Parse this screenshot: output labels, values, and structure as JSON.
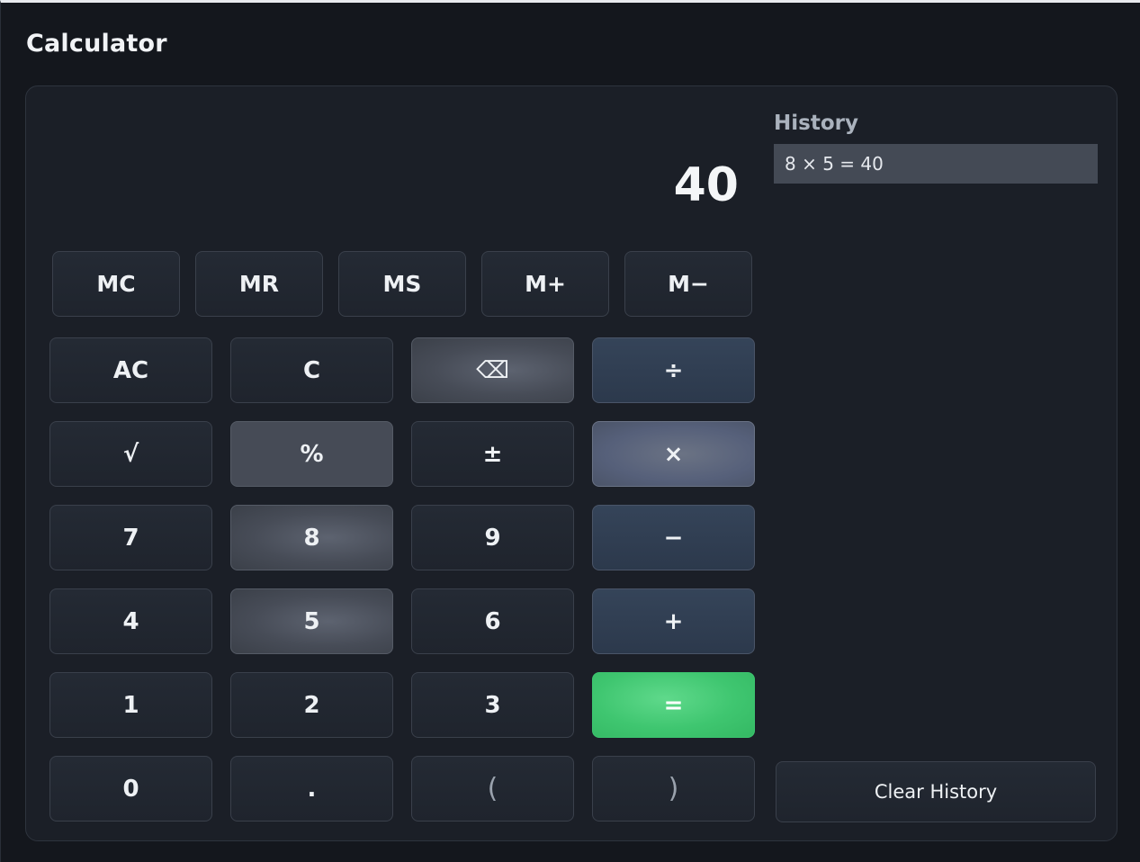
{
  "app": {
    "title": "Calculator"
  },
  "display": {
    "value": "40"
  },
  "memory_buttons": [
    "MC",
    "MR",
    "MS",
    "M+",
    "M−"
  ],
  "keys": {
    "ac": "AC",
    "c": "C",
    "backspace": "⌫",
    "divide": "÷",
    "sqrt": "√",
    "percent": "%",
    "plusminus": "±",
    "multiply": "×",
    "seven": "7",
    "eight": "8",
    "nine": "9",
    "minus": "−",
    "four": "4",
    "five": "5",
    "six": "6",
    "plus": "+",
    "one": "1",
    "two": "2",
    "three": "3",
    "equals": "=",
    "zero": "0",
    "decimal": ".",
    "lparen": "(",
    "rparen": ")"
  },
  "history": {
    "title": "History",
    "items": [
      "8 × 5 = 40"
    ],
    "clear_label": "Clear History"
  },
  "colors": {
    "background": "#14171d",
    "panel": "#1b1f27",
    "operator": "#354459",
    "equals": "#3fc670",
    "history_item": "#444a55"
  }
}
